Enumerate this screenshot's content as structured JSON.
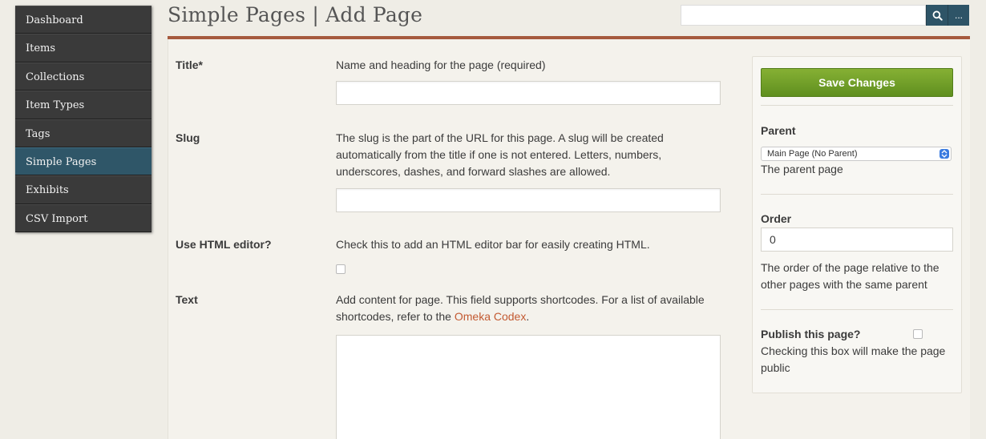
{
  "sidebar": {
    "items": [
      {
        "label": "Dashboard"
      },
      {
        "label": "Items"
      },
      {
        "label": "Collections"
      },
      {
        "label": "Item Types"
      },
      {
        "label": "Tags"
      },
      {
        "label": "Simple Pages"
      },
      {
        "label": "Exhibits"
      },
      {
        "label": "CSV Import"
      }
    ],
    "active_item": "Simple Pages"
  },
  "header": {
    "title": "Simple Pages | Add Page",
    "search": {
      "value": "",
      "placeholder": ""
    },
    "search_button_icon": "search-icon",
    "more_button_label": "..."
  },
  "form": {
    "title_field": {
      "label": "Title*",
      "description": "Name and heading for the page (required)",
      "value": ""
    },
    "slug_field": {
      "label": "Slug",
      "description": "The slug is the part of the URL for this page. A slug will be created automatically from the title if one is not entered. Letters, numbers, underscores, dashes, and forward slashes are allowed.",
      "value": ""
    },
    "html_editor_field": {
      "label": "Use HTML editor?",
      "description": "Check this to add an HTML editor bar for easily creating HTML.",
      "checked": false
    },
    "text_field": {
      "label": "Text",
      "description_prefix": "Add content for page. This field supports shortcodes. For a list of available shortcodes, refer to the ",
      "link_text": "Omeka Codex",
      "description_suffix": ".",
      "value": ""
    }
  },
  "side_panel": {
    "save_label": "Save Changes",
    "parent": {
      "label": "Parent",
      "selected": "Main Page (No Parent)",
      "help": "The parent page"
    },
    "order": {
      "label": "Order",
      "value": "0",
      "help": "The order of the page relative to the other pages with the same parent"
    },
    "publish": {
      "label": "Publish this page?",
      "checked": false,
      "help": "Checking this box will make the page public"
    }
  },
  "colors": {
    "accent_rule": "#a65a3e",
    "active_nav": "#2f5668",
    "save_button": "#6f9f28",
    "link": "#c35a32"
  }
}
